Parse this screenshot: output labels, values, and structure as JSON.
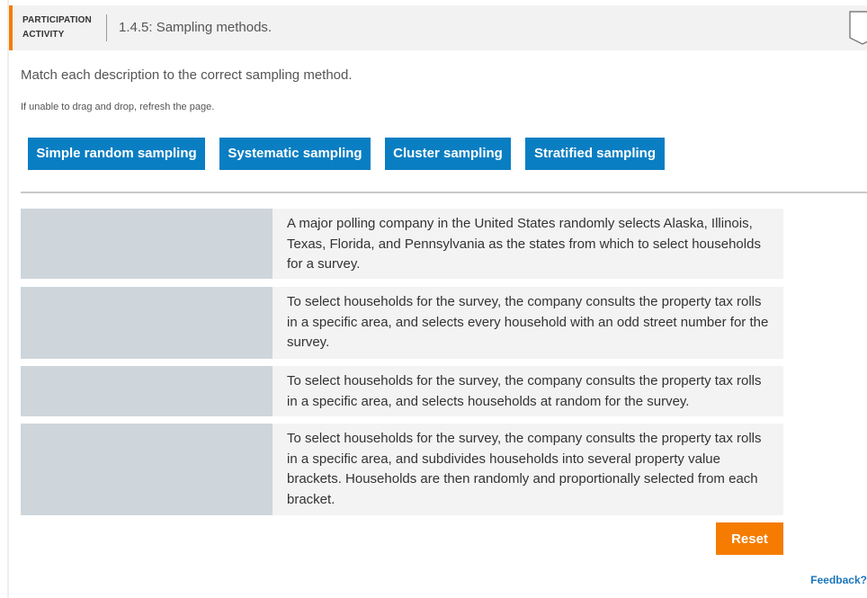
{
  "header": {
    "activity_label_line1": "PARTICIPATION",
    "activity_label_line2": "ACTIVITY",
    "title": "1.4.5: Sampling methods.",
    "accent_color": "#f57c00"
  },
  "instruction": "Match each description to the correct sampling method.",
  "hint": "If unable to drag and drop, refresh the page.",
  "tiles": [
    {
      "label": "Simple random sampling"
    },
    {
      "label": "Systematic sampling"
    },
    {
      "label": "Cluster sampling"
    },
    {
      "label": "Stratified sampling"
    }
  ],
  "rows": [
    {
      "description": "A major polling company in the United States randomly selects Alaska, Illinois, Texas, Florida, and Pennsylvania as the states from which to select households for a survey."
    },
    {
      "description": "To select households for the survey, the company consults the property tax rolls in a specific area, and selects every household with an odd street number for the survey."
    },
    {
      "description": "To select households for the survey, the company consults the property tax rolls in a specific area, and selects households at random for the survey."
    },
    {
      "description": "To select households for the survey, the company consults the property tax rolls in a specific area, and subdivides households into several property value brackets. Households are then randomly and proportionally selected from each bracket."
    }
  ],
  "reset_label": "Reset",
  "feedback_label": "Feedback?",
  "colors": {
    "tile": "#0a7ec2",
    "reset": "#f57c00",
    "drop_zone": "#ced6dc",
    "description_bg": "#f3f3f3",
    "link": "#1a75bb"
  }
}
